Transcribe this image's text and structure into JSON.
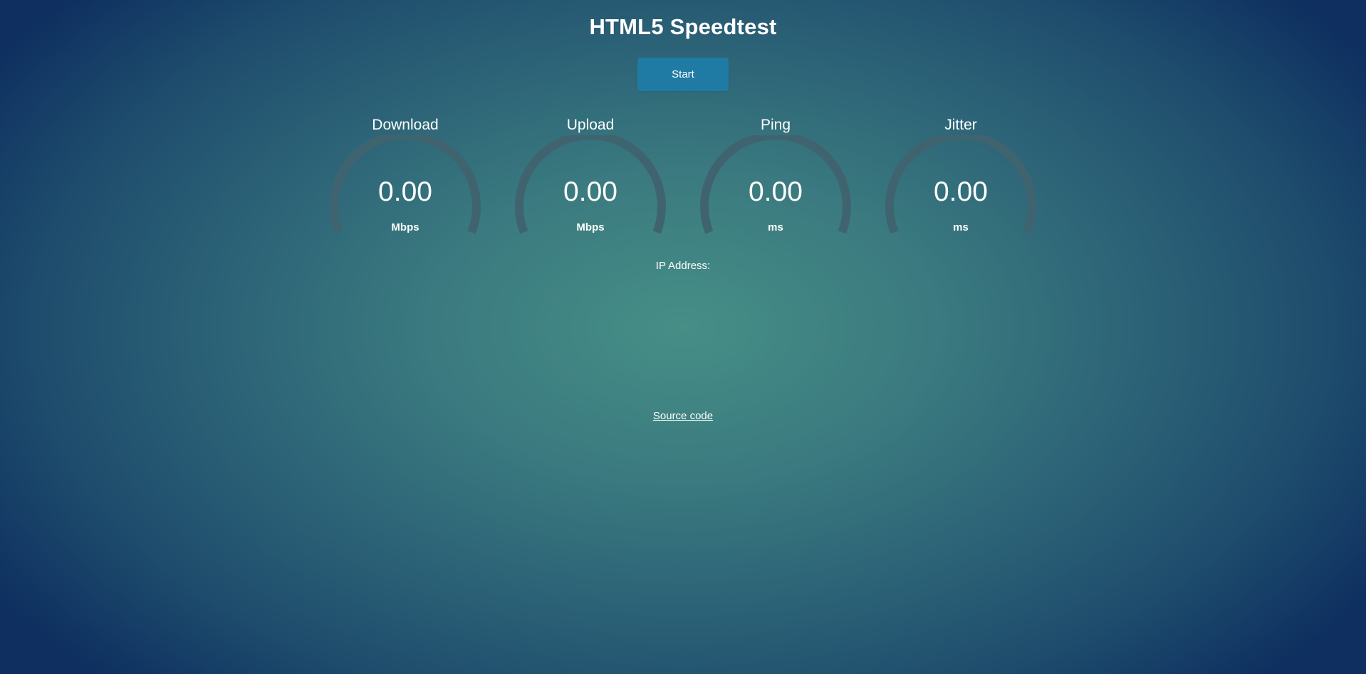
{
  "page": {
    "title": "HTML5 Speedtest",
    "start_label": "Start",
    "ip_label": "IP Address:",
    "source_label": "Source code"
  },
  "meters": [
    {
      "label": "Download",
      "value": "0.00",
      "unit": "Mbps"
    },
    {
      "label": "Upload",
      "value": "0.00",
      "unit": "Mbps"
    },
    {
      "label": "Ping",
      "value": "0.00",
      "unit": "ms"
    },
    {
      "label": "Jitter",
      "value": "0.00",
      "unit": "ms"
    }
  ],
  "colors": {
    "accent": "#1f7ba3",
    "gauge_track": "#3f6470"
  }
}
